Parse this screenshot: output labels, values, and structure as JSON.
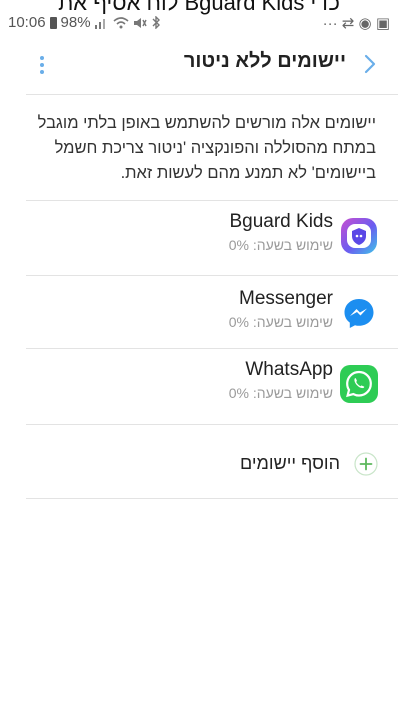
{
  "caption": "לוח אסיף את Bguard Kids כדי",
  "status": {
    "time": "10:06",
    "battery": "98%",
    "right_icons": "··· ⇄ ◉ ▣"
  },
  "header": {
    "title": "יישומים ללא ניטור"
  },
  "description": "יישומים אלה מורשים להשתמש באופן בלתי מוגבל במתח מהסוללה והפונקציה 'ניטור צריכת חשמל ביישומים' לא תמנע מהם לעשות זאת.",
  "apps": [
    {
      "name": "Bguard Kids",
      "usage": "שימוש בשעה: 0%"
    },
    {
      "name": "Messenger",
      "usage": "שימוש בשעה: 0%"
    },
    {
      "name": "WhatsApp",
      "usage": "שימוש בשעה: 0%"
    }
  ],
  "add_label": "הוסף יישומים",
  "colors": {
    "accent": "#6aaee9",
    "add_green": "#5cb85c",
    "whatsapp": "#2ecc55",
    "messenger": "#1c8ef0"
  }
}
